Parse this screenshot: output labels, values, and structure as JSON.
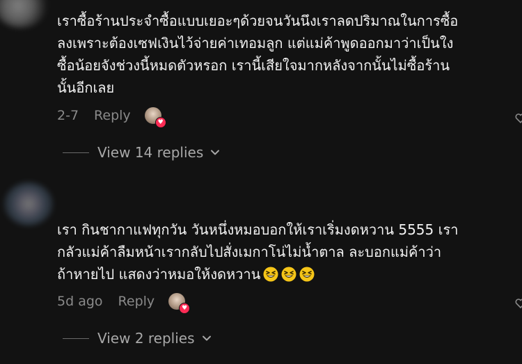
{
  "comments": [
    {
      "text": "เราซื้อร้านประจำซื้อแบบเยอะๆด้วยจนวันนึงเราลดปริมาณในการซื้อ\nลงเพราะต้องเซฟเงินไว้จ่ายค่าเทอมลูก แต่แม่ค้าพูดออกมาว่าเป็นใง\nซื้อน้อยจังช่วงนี้หมดตัวหรอก เรานี้เสียใจมากหลังจากนั้นไม่ซื้อร้าน\nนั้นอีกเลย",
      "time": "2-7",
      "reply_label": "Reply",
      "view_replies": "View 14 replies"
    },
    {
      "text": "เรา กินชากาแฟทุกวัน วันหนึ่งหมอบอกให้เราเริ่มงดหวาน 5555 เรา\nกลัวแม่ค้าลืมหน้าเรากลับไปสั่งเมกาโน่ไม่น้ำตาล ละบอกแม่ค้าว่า\nถ้าหายไป แสดงว่าหมอให้งดหวาน",
      "emoji_icon": "grinning-squinting-face-icon",
      "emoji_count": 3,
      "time": "5d ago",
      "reply_label": "Reply",
      "view_replies": "View 2 replies"
    }
  ],
  "colors": {
    "background": "#121212",
    "text": "#f2f2f2",
    "muted": "#8a8a8a",
    "heart_badge": "#fe2c55"
  }
}
